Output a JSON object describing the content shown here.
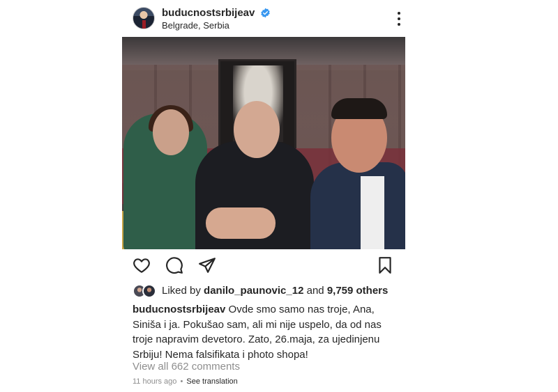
{
  "header": {
    "username": "buducnostsrbijeav",
    "location": "Belgrade, Serbia",
    "verified_color": "#3897f0"
  },
  "icons": {
    "like": "heart-icon",
    "comment": "comment-icon",
    "share": "paper-plane-icon",
    "save": "bookmark-icon",
    "more": "more-vertical-icon"
  },
  "likes": {
    "prefix": "Liked by ",
    "user": "danilo_paunovic_12",
    "and": " and ",
    "others": "9,759 others"
  },
  "caption": {
    "user": "buducnostsrbijeav",
    "text": "Ovde smo samo nas troje, Ana, Siniša i ja. Pokušao sam, ali mi nije uspelo, da od nas troje napravim devetoro. Zato, 26.maja, za ujedinjenu Srbiju! Nema falsifikata i photo shopa!"
  },
  "comments": {
    "view_all": "View all 662 comments"
  },
  "meta": {
    "time": "11 hours ago",
    "separator": "•",
    "translate": "See translation"
  }
}
